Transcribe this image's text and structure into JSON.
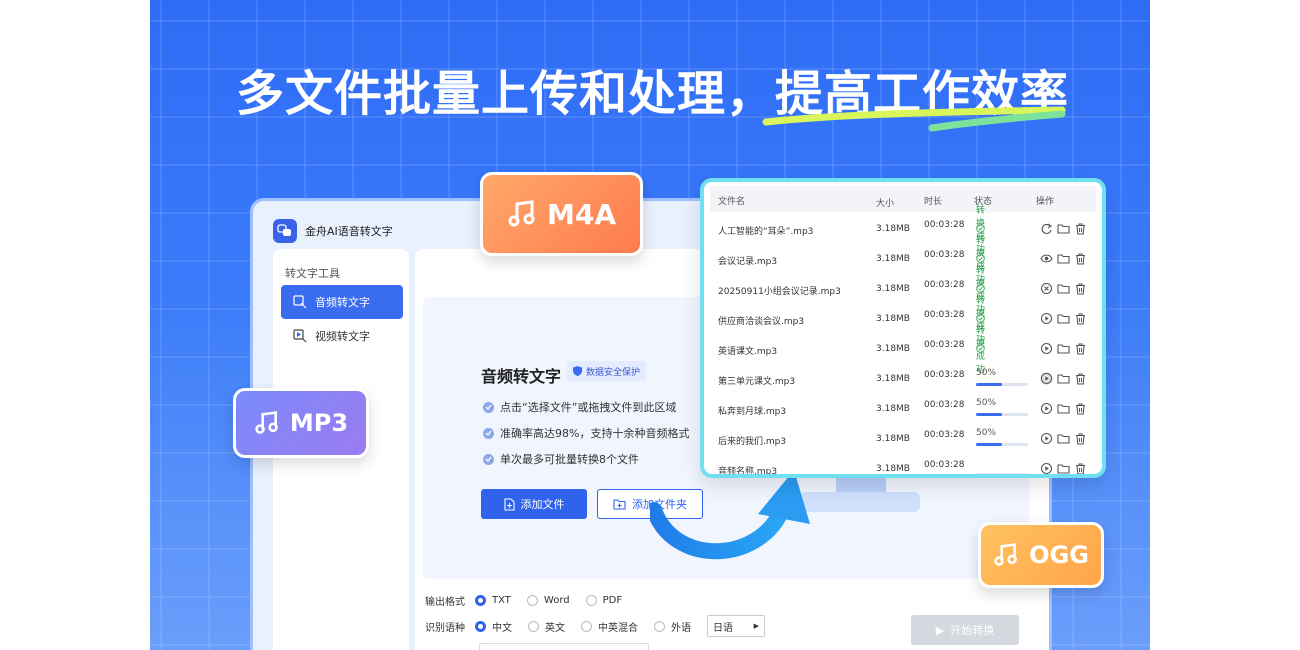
{
  "headline": {
    "part1": "多文件批量上传和处理，",
    "part2": "提高工作效率"
  },
  "app": {
    "title": "金舟AI语音转文字",
    "sidebar": {
      "heading": "转文字工具",
      "items": [
        {
          "label": "音频转文字",
          "icon": "audio-transcribe-icon",
          "active": true
        },
        {
          "label": "视频转文字",
          "icon": "video-transcribe-icon",
          "active": false
        }
      ]
    },
    "upload": {
      "title": "音频转文字",
      "badge": "数据安全保护",
      "bullets": [
        "点击“选择文件”或拖拽文件到此区域",
        "准确率高达98%，支持十余种音频格式",
        "单次最多可批量转换8个文件"
      ],
      "add_file": "添加文件",
      "add_folder": "添加文件夹"
    },
    "options": {
      "output_label": "输出格式",
      "output_formats": [
        "TXT",
        "Word",
        "PDF"
      ],
      "lang_label": "识别语种",
      "languages": [
        "中文",
        "英文",
        "中英混合",
        "外语"
      ],
      "foreign_selected": "日语",
      "start": "开始转换"
    }
  },
  "badges": {
    "m4a": "M4A",
    "mp3": "MP3",
    "ogg": "OGG"
  },
  "file_list": {
    "headers": {
      "name": "文件名",
      "size": "大小",
      "duration": "时长",
      "status": "状态",
      "ops": "操作"
    },
    "rows": [
      {
        "name": "人工智能的“耳朵”.mp3",
        "size": "3.18MB",
        "duration": "00:03:28",
        "status": "转换成功",
        "progress": null,
        "op1": "refresh"
      },
      {
        "name": "会议记录.mp3",
        "size": "3.18MB",
        "duration": "00:03:28",
        "status": "转换成功",
        "progress": null,
        "op1": "eye"
      },
      {
        "name": "20250911小组会议记录.mp3",
        "size": "3.18MB",
        "duration": "00:03:28",
        "status": "转换成功",
        "progress": null,
        "op1": "close"
      },
      {
        "name": "供应商洽谈会议.mp3",
        "size": "3.18MB",
        "duration": "00:03:28",
        "status": "转换成功",
        "progress": null,
        "op1": "play"
      },
      {
        "name": "英语课文.mp3",
        "size": "3.18MB",
        "duration": "00:03:28",
        "status": "转换成功",
        "progress": null,
        "op1": "play"
      },
      {
        "name": "第三单元课文.mp3",
        "size": "3.18MB",
        "duration": "00:03:28",
        "status": "50%",
        "progress": 0.5,
        "op1": "play"
      },
      {
        "name": "私奔到月球.mp3",
        "size": "3.18MB",
        "duration": "00:03:28",
        "status": "50%",
        "progress": 0.5,
        "op1": "play"
      },
      {
        "name": "后来的我们.mp3",
        "size": "3.18MB",
        "duration": "00:03:28",
        "status": "50%",
        "progress": 0.5,
        "op1": "play"
      },
      {
        "name": "音频名称.mp3",
        "size": "3.18MB",
        "duration": "00:03:28",
        "status": "",
        "progress": 0,
        "op1": "play"
      }
    ]
  },
  "colors": {
    "primary": "#2f63ee",
    "success": "#2aa34a",
    "panel_border": "#6ee0f0"
  }
}
